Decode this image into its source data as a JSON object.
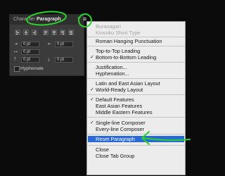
{
  "panel": {
    "tabs": [
      {
        "label": "Character"
      },
      {
        "label": "Paragraph"
      }
    ],
    "fields": [
      "0 pt",
      "0 pt",
      "0 pt",
      "0 pt",
      "0 pt"
    ],
    "hyphenate_label": "Hyphenate",
    "hyphenate_checked": false
  },
  "menu": {
    "items": [
      {
        "label": "Burasagari",
        "enabled": false
      },
      {
        "label": "Kinsoku Shori Type",
        "enabled": false
      },
      {
        "label": "Roman Hanging Punctuation",
        "enabled": true
      },
      {
        "label": "Top-to-Top Leading",
        "enabled": true
      },
      {
        "label": "Bottom-to-Bottom Leading",
        "enabled": true,
        "checked": true
      },
      {
        "label": "Justification...",
        "enabled": true
      },
      {
        "label": "Hyphenation...",
        "enabled": true
      },
      {
        "label": "Latin and East Asian Layout",
        "enabled": true
      },
      {
        "label": "World-Ready Layout",
        "enabled": true,
        "checked": true
      },
      {
        "label": "Default Features",
        "enabled": true,
        "checked": true
      },
      {
        "label": "East Asian Features",
        "enabled": true
      },
      {
        "label": "Middle Eastern Features",
        "enabled": true
      },
      {
        "label": "Single-line Composer",
        "enabled": true,
        "checked": true
      },
      {
        "label": "Every-line Composer",
        "enabled": true
      },
      {
        "label": "Reset Paragraph",
        "enabled": true,
        "highlighted": true
      },
      {
        "label": "Close",
        "enabled": true
      },
      {
        "label": "Close Tab Group",
        "enabled": true
      }
    ]
  },
  "colors": {
    "highlight": "#2a6ad6",
    "annotation": "#2bd12b",
    "panel_bg": "#3b3b3b",
    "menu_bg": "#ececec"
  }
}
